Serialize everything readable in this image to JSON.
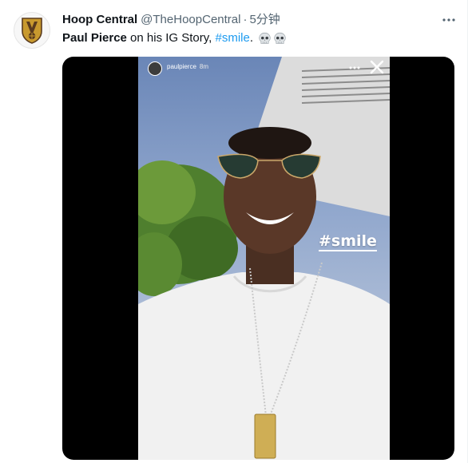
{
  "tweet": {
    "author_name": "Hoop Central",
    "author_handle": "@TheHoopCentral",
    "separator": "·",
    "timestamp": "5分钟",
    "avatar_icon": "hoop-central-shield-logo",
    "more_icon": "more-horizontal-icon",
    "text": {
      "bold": "Paul Pierce",
      "plain": " on his IG Story, ",
      "hashtag": "#smile",
      "period": ".",
      "emoji": [
        "skull-emoji",
        "skull-emoji"
      ]
    }
  },
  "media": {
    "story_username": "paulpierce",
    "story_time": "8m",
    "sticker_text": "#smile",
    "dots_icon": "more-horizontal-icon",
    "close_icon": "close-icon"
  },
  "colors": {
    "link": "#1d9bf0",
    "secondary_text": "#536471",
    "primary_text": "#0f1419",
    "logo_gold": "#c99a2e",
    "logo_brown": "#5a3b1e"
  }
}
